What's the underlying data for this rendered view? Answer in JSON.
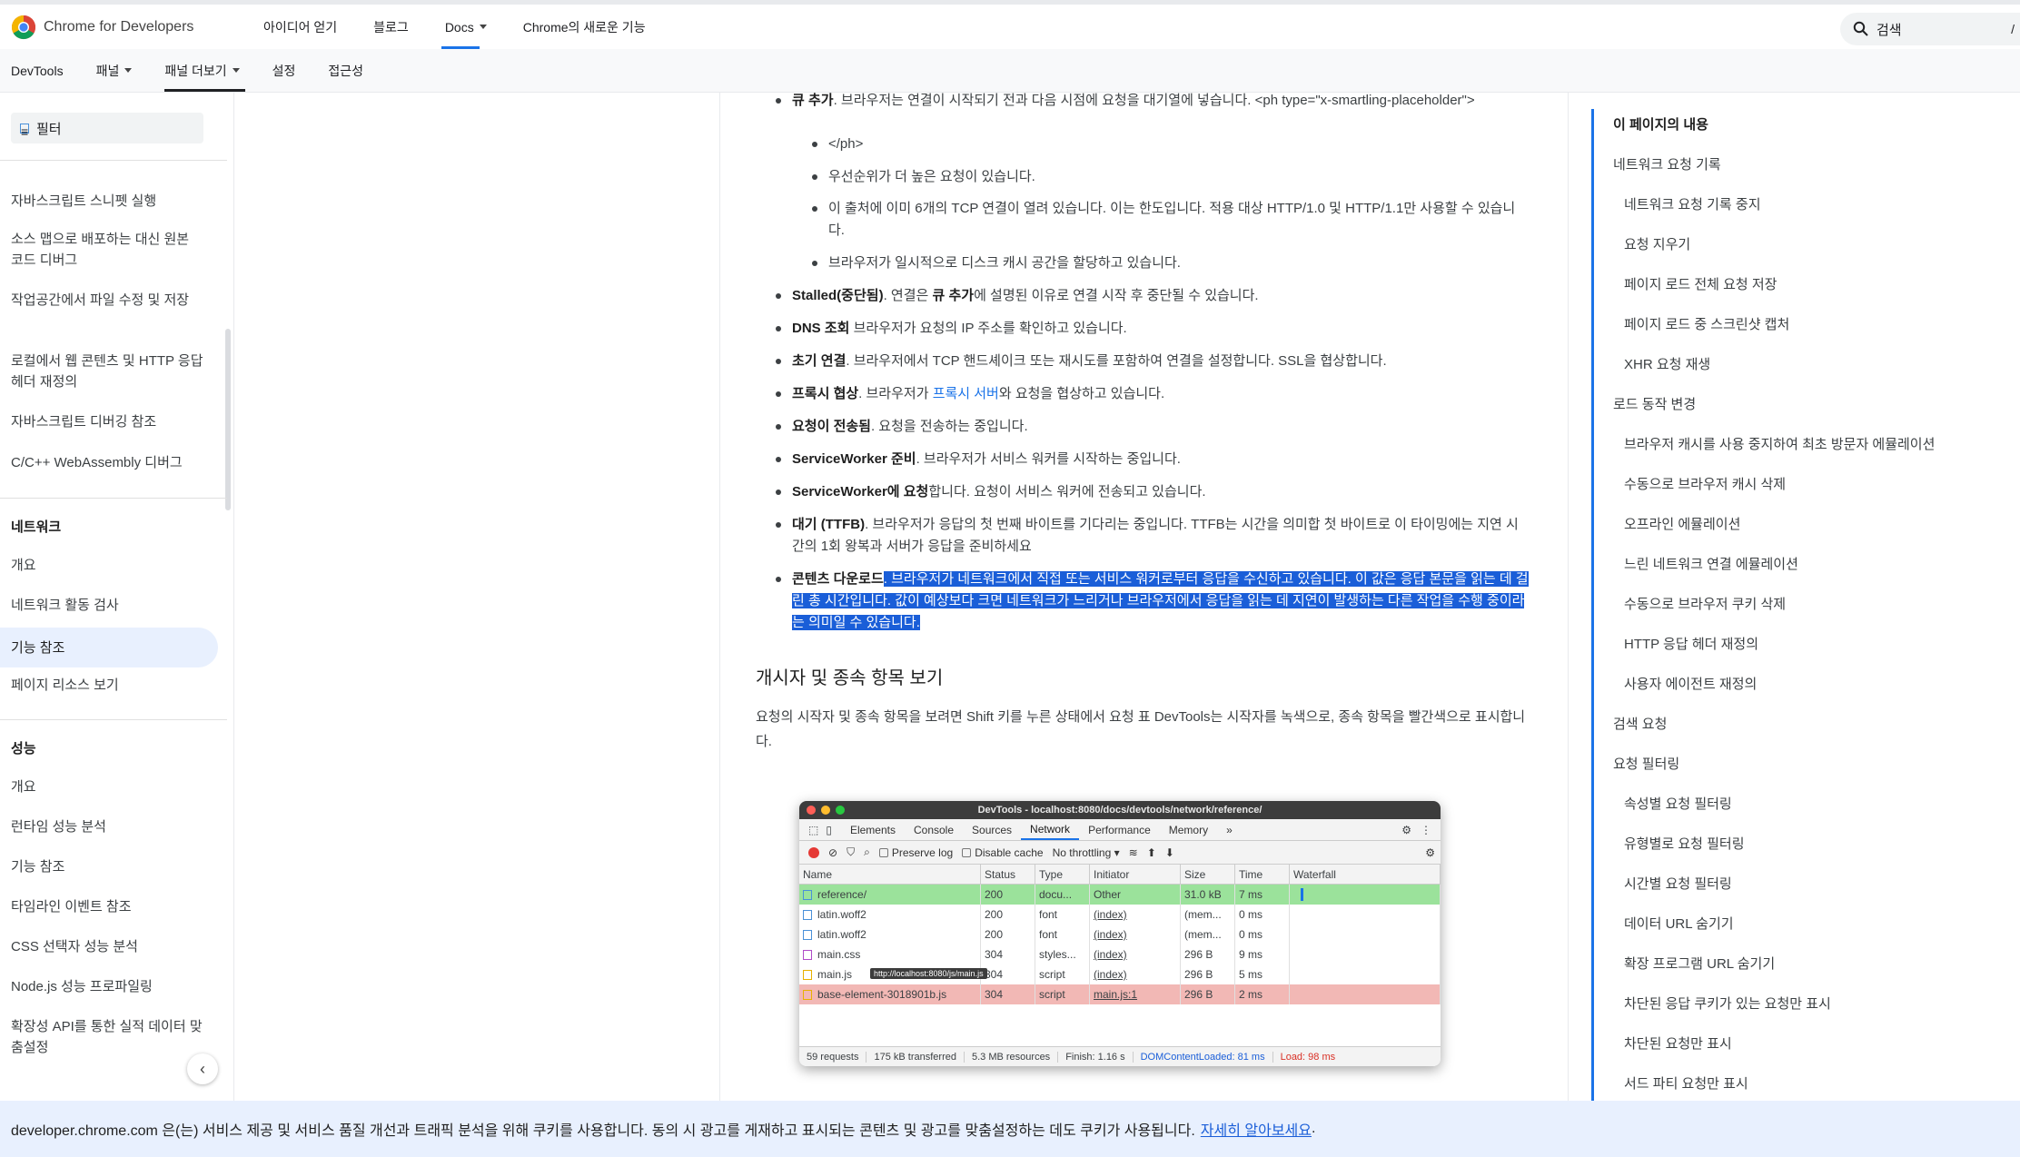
{
  "header": {
    "brand": "Chrome for Developers",
    "nav": [
      "아이디어 얻기",
      "블로그",
      "Docs",
      "Chrome의 새로운 기능"
    ],
    "search_placeholder": "검색",
    "search_shortcut": "/"
  },
  "subnav": [
    "DevTools",
    "패널",
    "패널 더보기",
    "설정",
    "접근성"
  ],
  "sidebar": {
    "filter": "필터",
    "items": [
      "자바스크립트 스니펫 실행",
      "소스 맵으로 배포하는 대신 원본 코드 디버그",
      "작업공간에서 파일 수정 및 저장",
      "로컬에서 웹 콘텐츠 및 HTTP 응답 헤더 재정의",
      "자바스크립트 디버깅 참조",
      "C/C++ WebAssembly 디버그"
    ],
    "network_head": "네트워크",
    "network": [
      "개요",
      "네트워크 활동 검사",
      "기능 참조",
      "페이지 리소스 보기"
    ],
    "perf_head": "성능",
    "perf": [
      "개요",
      "런타임 성능 분석",
      "기능 참조",
      "타임라인 이벤트 참조",
      "CSS 선택자 성능 분석",
      "Node.js 성능 프로파일링",
      "확장성 API를 통한 실적 데이터 맞춤설정"
    ]
  },
  "main": {
    "queue_title": "큐 추가",
    "queue_text": ". 브라우저는 연결이 시작되기 전과 다음 시점에 요청을 대기열에 넣습니다. <ph type=\"x-smartling-placeholder\">",
    "queue_text2": "</ph>",
    "sub": [
      "우선순위가 더 높은 요청이 있습니다.",
      "이 출처에 이미 6개의 TCP 연결이 열려 있습니다. 이는 한도입니다. 적용 대상 HTTP/1.0 및 HTTP/1.1만 사용할 수 있습니다.",
      "브라우저가 일시적으로 디스크 캐시 공간을 할당하고 있습니다."
    ],
    "stalled_title": "Stalled(중단됨)",
    "stalled_a": ". 연결은 ",
    "stalled_b": "큐 추가",
    "stalled_c": "에 설명된 이유로 연결 시작 후 중단될 수 있습니다.",
    "dns_title": "DNS 조회",
    "dns_text": " 브라우저가 요청의 IP 주소를 확인하고 있습니다.",
    "init_title": "초기 연결",
    "init_text": ". 브라우저에서 TCP 핸드셰이크 또는 재시도를 포함하여 연결을 설정합니다. SSL을 협상합니다.",
    "proxy_title": "프록시 협상",
    "proxy_a": ". 브라우저가 ",
    "proxy_link": "프록시 서버",
    "proxy_b": "와 요청을 협상하고 있습니다.",
    "sent_title": "요청이 전송됨",
    "sent_text": ". 요청을 전송하는 중입니다.",
    "sw_title": "ServiceWorker 준비",
    "sw_text": ". 브라우저가 서비스 워커를 시작하는 중입니다.",
    "swreq_title": "ServiceWorker에 요청",
    "swreq_text": "합니다. 요청이 서비스 워커에 전송되고 있습니다.",
    "ttfb_title": "대기 (TTFB)",
    "ttfb_text": ". 브라우저가 응답의 첫 번째 바이트를 기다리는 중입니다. TTFB는 시간을 의미합 첫 바이트로 이 타이밍에는 지연 시간의 1회 왕복과 서버가 응답을 준비하세요",
    "dl_title": "콘텐츠 다운로드",
    "dl_text": ". 브라우저가 네트워크에서 직접 또는 서비스 워커로부터 응답을 수신하고 있습니다. 이 값은 응답 본문을 읽는 데 걸린 총 시간입니다. 값이 예상보다 크면 네트워크가 느리거나 브라우저에서 응답을 읽는 데 지연이 발생하는 다른 작업을 수행 중이라는 의미일 수 있습니다.",
    "h3": "개시자 및 종속 항목 보기",
    "para": "요청의 시작자 및 종속 항목을 보려면 Shift 키를 누른 상태에서 요청 표 DevTools는 시작자를 녹색으로, 종속 항목을 빨간색으로 표시합니다."
  },
  "devtools": {
    "title": "DevTools - localhost:8080/docs/devtools/network/reference/",
    "tabs": [
      "Elements",
      "Console",
      "Sources",
      "Network",
      "Performance",
      "Memory",
      "»"
    ],
    "preserve": "Preserve log",
    "disable": "Disable cache",
    "throttle": "No throttling",
    "cols": [
      "Name",
      "Status",
      "Type",
      "Initiator",
      "Size",
      "Time",
      "Waterfall"
    ],
    "rows": [
      {
        "name": "reference/",
        "status": "200",
        "type": "docu...",
        "init": "Other",
        "size": "31.0 kB",
        "time": "7 ms"
      },
      {
        "name": "latin.woff2",
        "status": "200",
        "type": "font",
        "init": "(index)",
        "size": "(mem...",
        "time": "0 ms"
      },
      {
        "name": "latin.woff2",
        "status": "200",
        "type": "font",
        "init": "(index)",
        "size": "(mem...",
        "time": "0 ms"
      },
      {
        "name": "main.css",
        "status": "304",
        "type": "styles...",
        "init": "(index)",
        "size": "296 B",
        "time": "9 ms"
      },
      {
        "name": "main.js",
        "status": "304",
        "type": "script",
        "init": "(index)",
        "size": "296 B",
        "time": "5 ms"
      },
      {
        "name": "base-element-3018901b.js",
        "status": "304",
        "type": "script",
        "init": "main.js:1",
        "size": "296 B",
        "time": "2 ms"
      }
    ],
    "tooltip": "http://localhost:8080/js/main.js",
    "status": [
      "59 requests",
      "175 kB transferred",
      "5.3 MB resources",
      "Finish: 1.16 s",
      "DOMContentLoaded: 81 ms",
      "Load: 98 ms"
    ]
  },
  "toc": {
    "title": "이 페이지의 내용",
    "items": [
      {
        "t": "네트워크 요청 기록",
        "l": 0
      },
      {
        "t": "네트워크 요청 기록 중지",
        "l": 1
      },
      {
        "t": "요청 지우기",
        "l": 1
      },
      {
        "t": "페이지 로드 전체 요청 저장",
        "l": 1
      },
      {
        "t": "페이지 로드 중 스크린샷 캡처",
        "l": 1
      },
      {
        "t": "XHR 요청 재생",
        "l": 1
      },
      {
        "t": "로드 동작 변경",
        "l": 0
      },
      {
        "t": "브라우저 캐시를 사용 중지하여 최초 방문자 에뮬레이션",
        "l": 1
      },
      {
        "t": "수동으로 브라우저 캐시 삭제",
        "l": 1
      },
      {
        "t": "오프라인 에뮬레이션",
        "l": 1
      },
      {
        "t": "느린 네트워크 연결 에뮬레이션",
        "l": 1
      },
      {
        "t": "수동으로 브라우저 쿠키 삭제",
        "l": 1
      },
      {
        "t": "HTTP 응답 헤더 재정의",
        "l": 1
      },
      {
        "t": "사용자 에이전트 재정의",
        "l": 1
      },
      {
        "t": "검색 요청",
        "l": 0
      },
      {
        "t": "요청 필터링",
        "l": 0
      },
      {
        "t": "속성별 요청 필터링",
        "l": 1
      },
      {
        "t": "유형별로 요청 필터링",
        "l": 1
      },
      {
        "t": "시간별 요청 필터링",
        "l": 1
      },
      {
        "t": "데이터 URL 숨기기",
        "l": 1
      },
      {
        "t": "확장 프로그램 URL 숨기기",
        "l": 1
      },
      {
        "t": "차단된 응답 쿠키가 있는 요청만 표시",
        "l": 1
      },
      {
        "t": "차단된 요청만 표시",
        "l": 1
      },
      {
        "t": "서드 파티 요청만 표시",
        "l": 1
      }
    ]
  },
  "cookie": {
    "text": "developer.chrome.com 은(는) 서비스 제공 및 서비스 품질 개선과 트래픽 분석을 위해 쿠키를 사용합니다. 동의 시 광고를 게재하고 표시되는 콘텐츠 및 광고를 맞춤설정하는 데도 쿠키가 사용됩니다.",
    "link": "자세히 알아보세요",
    "tail": "."
  }
}
